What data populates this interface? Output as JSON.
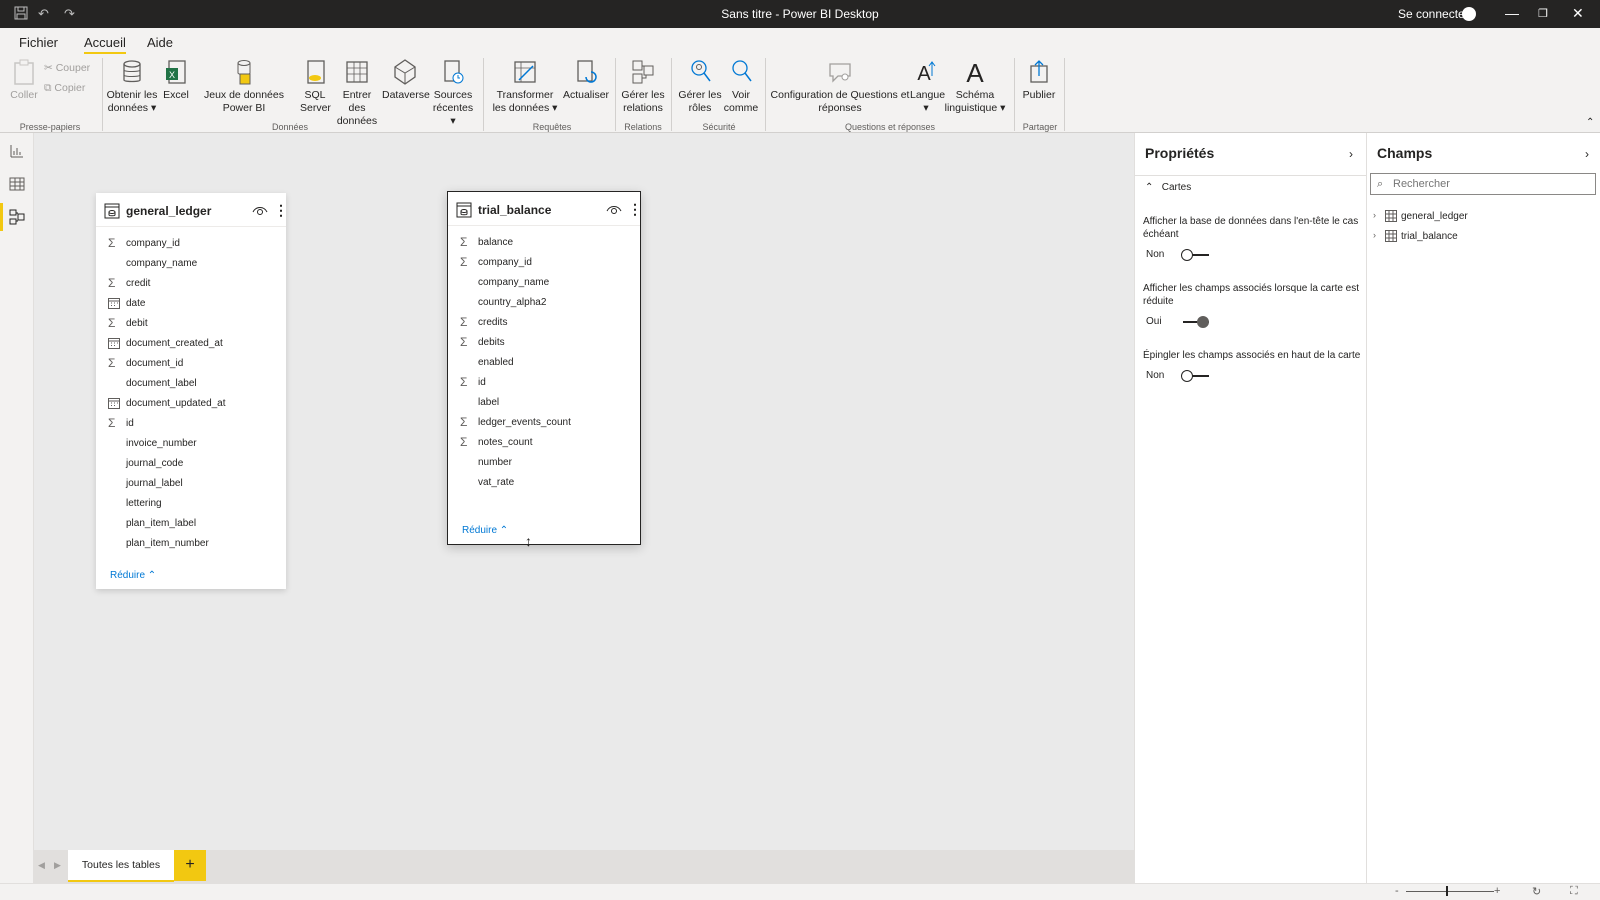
{
  "window": {
    "title": "Sans titre - Power BI Desktop",
    "signin": "Se connecter"
  },
  "menu": {
    "tabs": [
      "Fichier",
      "Accueil",
      "Aide"
    ],
    "active": "Accueil"
  },
  "ribbon": {
    "clipboard": {
      "paste": "Coller",
      "cut": "Couper",
      "copy": "Copier",
      "group": "Presse-papiers"
    },
    "data": {
      "get_data": "Obtenir les données",
      "excel": "Excel",
      "pbi_datasets": "Jeux de données Power BI",
      "sql": "SQL Server",
      "enter_data": "Entrer des données",
      "dataverse": "Dataverse",
      "recent": "Sources récentes",
      "group": "Données"
    },
    "queries": {
      "transform": "Transformer les données",
      "refresh": "Actualiser",
      "group": "Requêtes"
    },
    "relations": {
      "manage": "Gérer les relations",
      "group": "Relations"
    },
    "security": {
      "roles": "Gérer les rôles",
      "view_as": "Voir comme",
      "group": "Sécurité"
    },
    "qna": {
      "setup": "Configuration de Questions et réponses",
      "language": "Langue",
      "schema": "Schéma linguistique",
      "group": "Questions et réponses"
    },
    "share": {
      "publish": "Publier",
      "group": "Partager"
    }
  },
  "cards": [
    {
      "name": "general_ledger",
      "fields": [
        {
          "name": "company_id",
          "icon": "sigma"
        },
        {
          "name": "company_name",
          "icon": ""
        },
        {
          "name": "credit",
          "icon": "sigma"
        },
        {
          "name": "date",
          "icon": "calendar"
        },
        {
          "name": "debit",
          "icon": "sigma"
        },
        {
          "name": "document_created_at",
          "icon": "calendar"
        },
        {
          "name": "document_id",
          "icon": "sigma"
        },
        {
          "name": "document_label",
          "icon": ""
        },
        {
          "name": "document_updated_at",
          "icon": "calendar"
        },
        {
          "name": "id",
          "icon": "sigma"
        },
        {
          "name": "invoice_number",
          "icon": ""
        },
        {
          "name": "journal_code",
          "icon": ""
        },
        {
          "name": "journal_label",
          "icon": ""
        },
        {
          "name": "lettering",
          "icon": ""
        },
        {
          "name": "plan_item_label",
          "icon": ""
        },
        {
          "name": "plan_item_number",
          "icon": ""
        }
      ],
      "reduce": "Réduire"
    },
    {
      "name": "trial_balance",
      "fields": [
        {
          "name": "balance",
          "icon": "sigma"
        },
        {
          "name": "company_id",
          "icon": "sigma"
        },
        {
          "name": "company_name",
          "icon": ""
        },
        {
          "name": "country_alpha2",
          "icon": ""
        },
        {
          "name": "credits",
          "icon": "sigma"
        },
        {
          "name": "debits",
          "icon": "sigma"
        },
        {
          "name": "enabled",
          "icon": ""
        },
        {
          "name": "id",
          "icon": "sigma"
        },
        {
          "name": "label",
          "icon": ""
        },
        {
          "name": "ledger_events_count",
          "icon": "sigma"
        },
        {
          "name": "notes_count",
          "icon": "sigma"
        },
        {
          "name": "number",
          "icon": ""
        },
        {
          "name": "vat_rate",
          "icon": ""
        }
      ],
      "reduce": "Réduire"
    }
  ],
  "tabs": {
    "all_tables": "Toutes les tables",
    "add": "+"
  },
  "properties": {
    "title": "Propriétés",
    "section": "Cartes",
    "options": [
      {
        "label": "Afficher la base de données dans l'en-tête le cas échéant",
        "state": "Non",
        "on": false
      },
      {
        "label": "Afficher les champs associés lorsque la carte est réduite",
        "state": "Oui",
        "on": true
      },
      {
        "label": "Épingler les champs associés en haut de la carte",
        "state": "Non",
        "on": false
      }
    ]
  },
  "fields_pane": {
    "title": "Champs",
    "search_placeholder": "Rechercher",
    "tables": [
      "general_ledger",
      "trial_balance"
    ]
  },
  "colors": {
    "accent": "#f2c811",
    "link": "#0078d4",
    "titlebar": "#252423"
  }
}
